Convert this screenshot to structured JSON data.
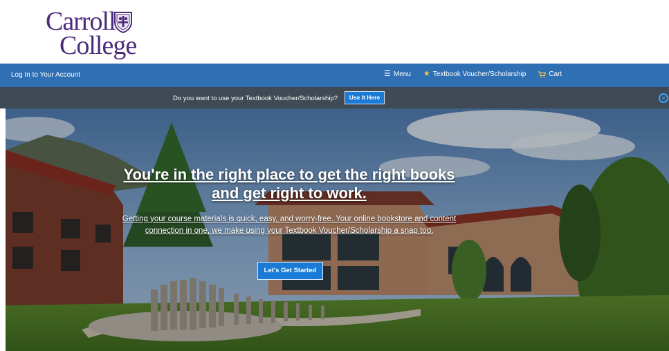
{
  "logo": {
    "line1": "Carroll",
    "line2": "College",
    "crest_icon": "shield-crest-icon"
  },
  "topnav": {
    "login_label": "Log In to Your Account",
    "menu_label": "Menu",
    "menu_icon": "hamburger-icon",
    "voucher_label": "Textbook Voucher/Scholarship",
    "voucher_icon": "star-icon",
    "cart_label": "Cart",
    "cart_icon": "cart-icon"
  },
  "voucher_bar": {
    "message": "Do you want to use your Textbook Voucher/Scholarship?",
    "button_label": "Use It Here",
    "close_icon": "close-circle-icon"
  },
  "hero": {
    "title": "You're in the right place to get the right books and get right to work.",
    "subtitle": "Getting your course materials is quick, easy, and worry-free. Your online bookstore and content connection in one, we make using your Textbook Voucher/Scholarship a snap too.",
    "cta_label": "Let's Get Started"
  },
  "colors": {
    "brand_purple": "#4a2a7a",
    "nav_blue": "#2f6fb3",
    "voucher_bar": "#3f4a55",
    "button_blue": "#1a7bd6",
    "star_yellow": "#f2c94c"
  }
}
